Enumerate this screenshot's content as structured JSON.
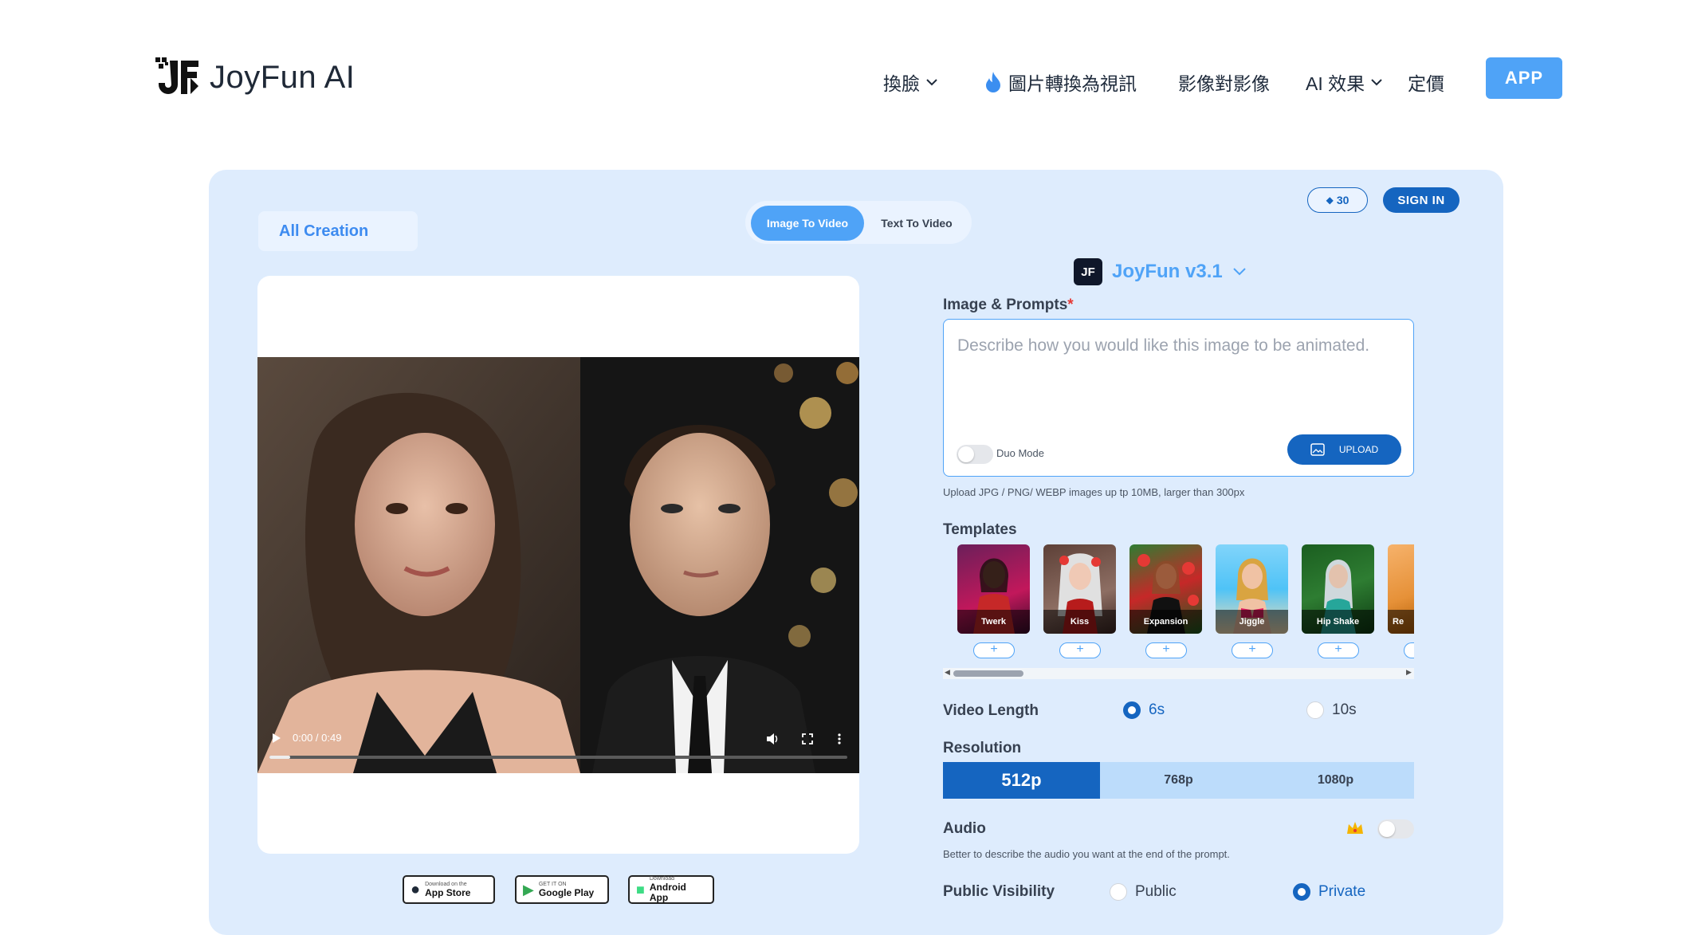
{
  "header": {
    "logo_text": "JoyFun AI",
    "nav": [
      {
        "label": "換臉",
        "has_dropdown": true
      },
      {
        "label": "圖片轉換為視訊",
        "icon": "flame-icon"
      },
      {
        "label": "影像對影像"
      },
      {
        "label": "AI 效果",
        "has_dropdown": true
      },
      {
        "label": "定價"
      }
    ],
    "app_button": "APP"
  },
  "panel": {
    "all_creation": "All Creation",
    "tabs": [
      {
        "label": "Image To Video",
        "active": true
      },
      {
        "label": "Text To Video",
        "active": false
      }
    ],
    "credits": "30",
    "sign_in": "SIGN IN"
  },
  "video": {
    "time": "0:00 / 0:49",
    "progress": 0.03
  },
  "stores": [
    {
      "small": "Download on the",
      "big": "App Store"
    },
    {
      "small": "GET IT ON",
      "big": "Google Play"
    },
    {
      "small": "Download",
      "big": "Android App"
    }
  ],
  "form": {
    "model": "JoyFun v3.1",
    "image_prompts_label": "Image & Prompts",
    "required_mark": "*",
    "prompt_placeholder": "Describe how you would like this image to be animated.",
    "duo_mode": "Duo Mode",
    "upload": "UPLOAD",
    "upload_hint": "Upload JPG / PNG/ WEBP images up tp 10MB, larger than 300px",
    "templates_label": "Templates",
    "templates": [
      "Twerk",
      "Kiss",
      "Expansion",
      "Jiggle",
      "Hip Shake",
      "Re"
    ],
    "video_length_label": "Video Length",
    "video_length_options": [
      {
        "label": "6s",
        "selected": true
      },
      {
        "label": "10s",
        "selected": false
      }
    ],
    "resolution_label": "Resolution",
    "resolutions": [
      {
        "label": "512p",
        "selected": true
      },
      {
        "label": "768p"
      },
      {
        "label": "1080p"
      }
    ],
    "audio_label": "Audio",
    "audio_hint": "Better to describe the audio you want at the end of the prompt.",
    "visibility_label": "Public Visibility",
    "visibility_options": [
      {
        "label": "Public",
        "selected": false
      },
      {
        "label": "Private",
        "selected": true
      }
    ]
  },
  "colors": {
    "accent": "#4fa3f7",
    "primary": "#1565c0",
    "panel_bg": "#deecfd"
  }
}
